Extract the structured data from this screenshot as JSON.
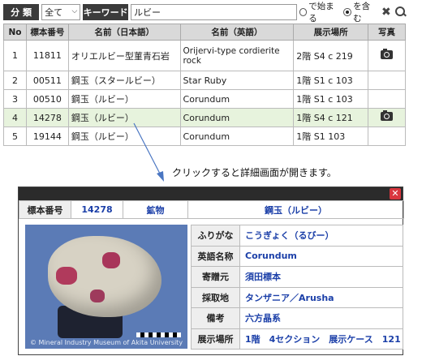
{
  "search": {
    "category_label": "分 類",
    "category_value": "全て",
    "keyword_label": "キーワード",
    "keyword_value": "ルビー",
    "opt_starts": "で始まる",
    "opt_contains": "を含む"
  },
  "table": {
    "headers": [
      "No",
      "標本番号",
      "名前（日本語）",
      "名前（英語）",
      "展示場所",
      "写真"
    ],
    "rows": [
      {
        "no": "1",
        "id": "11811",
        "ja": "オリエルビー型菫青石岩",
        "en": "Orijervi-type cordierite rock",
        "loc": "2階 S4 c 219",
        "photo": true
      },
      {
        "no": "2",
        "id": "00511",
        "ja": "鋼玉（スタールビー）",
        "en": "Star Ruby",
        "loc": "1階 S1 c 103",
        "photo": false
      },
      {
        "no": "3",
        "id": "00510",
        "ja": "鋼玉（ルビー）",
        "en": "Corundum",
        "loc": "1階 S1 c 103",
        "photo": false
      },
      {
        "no": "4",
        "id": "14278",
        "ja": "鋼玉（ルビー）",
        "en": "Corundum",
        "loc": "1階 S4 c 121",
        "photo": true
      },
      {
        "no": "5",
        "id": "19144",
        "ja": "鋼玉（ルビー）",
        "en": "Corundum",
        "loc": "1階 S1 103",
        "photo": false
      }
    ]
  },
  "caption": "クリックすると詳細画面が開きます。",
  "detail": {
    "id_label": "標本番号",
    "id_value": "14278",
    "type": "鉱物",
    "name": "鋼玉（ルビー）",
    "photo_credit": "© Mineral Industry Museum of Akita University",
    "fields": [
      {
        "key": "ふりがな",
        "value": "こうぎょく（るびー）"
      },
      {
        "key": "英語名称",
        "value": "Corundum"
      },
      {
        "key": "寄贈元",
        "value": "須田標本"
      },
      {
        "key": "採取地",
        "value": "タンザニア／Arusha"
      },
      {
        "key": "備考",
        "value": "六方晶系"
      },
      {
        "key": "展示場所",
        "value": "1階　4セクション　展示ケース　121"
      }
    ]
  }
}
